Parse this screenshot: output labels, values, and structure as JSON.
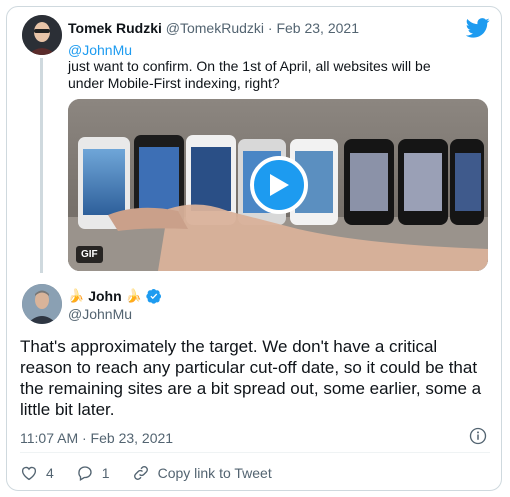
{
  "quoted": {
    "display_name": "Tomek Rudzki",
    "handle": "@TomekRudzki",
    "separator": " · ",
    "date": "Feb 23, 2021",
    "mention": "@JohnMu",
    "text": " just want to confirm. On the 1st of April, all websites will be under Mobile-First indexing, right?",
    "media_badge": "GIF"
  },
  "tweet": {
    "display_name": "John",
    "handle": "@JohnMu",
    "text": "That's approximately the target. We don't have a critical reason to reach any particular cut-off date, so it could be that the remaining sites are a bit spread out, some earlier, some a little bit later.",
    "timestamp": "11:07 AM · Feb 23, 2021"
  },
  "actions": {
    "like_count": "4",
    "reply_count": "1",
    "copy_link_label": "Copy link to Tweet"
  },
  "colors": {
    "accent": "#1d9bf0",
    "text": "#0f1419",
    "muted": "#536471",
    "border": "#cfd9de"
  },
  "icons": [
    "twitter-bird-icon",
    "play-icon",
    "verified-badge-icon",
    "banana-icon",
    "info-icon",
    "heart-icon",
    "reply-icon",
    "link-icon"
  ]
}
